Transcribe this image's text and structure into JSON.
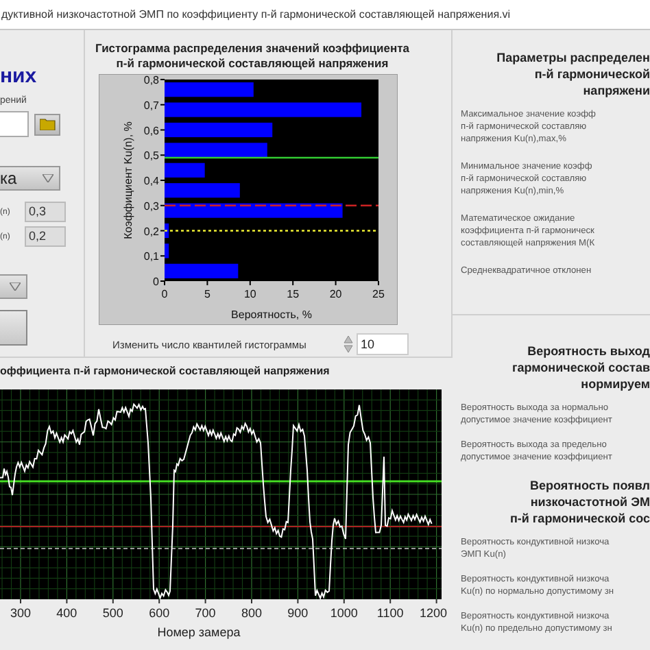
{
  "window": {
    "title": "дуктивной низкочастотной ЭМП по коэффициенту п-й гармонической составляющей напряжения.vi"
  },
  "left_panel": {
    "heading": "них",
    "file_label": "рений",
    "dropdowns": [
      {
        "value": "ка"
      }
    ],
    "params": [
      {
        "label": "(n)",
        "value": "0,3"
      },
      {
        "label": "(n)",
        "value": "0,2"
      }
    ]
  },
  "histogram": {
    "title": "Гистограмма распределения значений коэффициента\nп-й гармонической составляющей напряжения",
    "chart_data": {
      "type": "bar",
      "orientation": "horizontal",
      "xlabel": "Вероятность, %",
      "ylabel": "Коэффициент Ku(n), %",
      "xlim": [
        0,
        25
      ],
      "ylim": [
        0,
        0.8
      ],
      "xticks": [
        {
          "value": 0,
          "label": "0"
        },
        {
          "value": 5,
          "label": "5"
        },
        {
          "value": 10,
          "label": "10"
        },
        {
          "value": 15,
          "label": "15"
        },
        {
          "value": 20,
          "label": "20"
        },
        {
          "value": 25,
          "label": "25"
        }
      ],
      "yticks": [
        {
          "value": 0,
          "label": "0"
        },
        {
          "value": 0.1,
          "label": "0,1"
        },
        {
          "value": 0.2,
          "label": "0,2"
        },
        {
          "value": 0.3,
          "label": "0,3"
        },
        {
          "value": 0.4,
          "label": "0,4"
        },
        {
          "value": 0.5,
          "label": "0,5"
        },
        {
          "value": 0.6,
          "label": "0,6"
        },
        {
          "value": 0.7,
          "label": "0,7"
        },
        {
          "value": 0.8,
          "label": "0,8"
        }
      ],
      "x": [
        0.04,
        0.12,
        0.2,
        0.28,
        0.36,
        0.44,
        0.52,
        0.6,
        0.68,
        0.76
      ],
      "series": [
        {
          "color": "#0000ff",
          "values": [
            8.6,
            0.5,
            0.5,
            20.8,
            8.8,
            4.7,
            12,
            12.6,
            23,
            10.4
          ]
        }
      ],
      "ref_lines": [
        {
          "axis": "y",
          "value": 0.49,
          "color": "#33cc33"
        },
        {
          "axis": "y",
          "value": 0.3,
          "color": "#cc2222"
        },
        {
          "axis": "y",
          "value": 0.2,
          "color": "#eeee33"
        }
      ]
    },
    "quantile_label": "Изменить число квантилей гистограммы",
    "quantile_value": "10"
  },
  "trend_chart": {
    "title": "оффициента п-й гармонической составляющей напряжения",
    "x_tick_labels": [
      "300",
      "400",
      "500",
      "600",
      "700",
      "800",
      "900",
      "1000",
      "1100",
      "1200"
    ],
    "xlabel": "Номер замера"
  },
  "right_panel": [
    {
      "groups": [
        {
          "heading": "Параметры распределен\nп-й гармонической\nнапряжени",
          "items": [
            "Максимальное значение коэфф\nп-й гармонической составляю\nнапряжения Ku(n),max,%",
            "Минимальное значение коэфф\nп-й гармонической составляю\nнапряжения Ku(n),min,%",
            "Математическое ожидание\nкоэффициента п-й гармоническ\nсоставляющей напряжения М(К",
            "Среднеквадратичное отклонен"
          ]
        }
      ]
    },
    {
      "groups": [
        {
          "heading": "Вероятность выход\nгармонической состав\nнормируем",
          "items": [
            "Вероятность выхода за нормально\nдопустимое значение коэффициент",
            "Вероятность выхода за предельно\nдопустимое значение коэффициент"
          ]
        },
        {
          "heading": "Вероятность появл\nнизкочастотной ЭМ\nп-й гармонической сос",
          "items": [
            "Вероятность кондуктивной низкоча\nЭМП Ku(n)",
            "Вероятность кондуктивной низкоча\nKu(n) по нормально допустимому зн",
            "Вероятность кондуктивной низкоча\nKu(n) по предельно допустимому зн"
          ]
        }
      ]
    }
  ]
}
